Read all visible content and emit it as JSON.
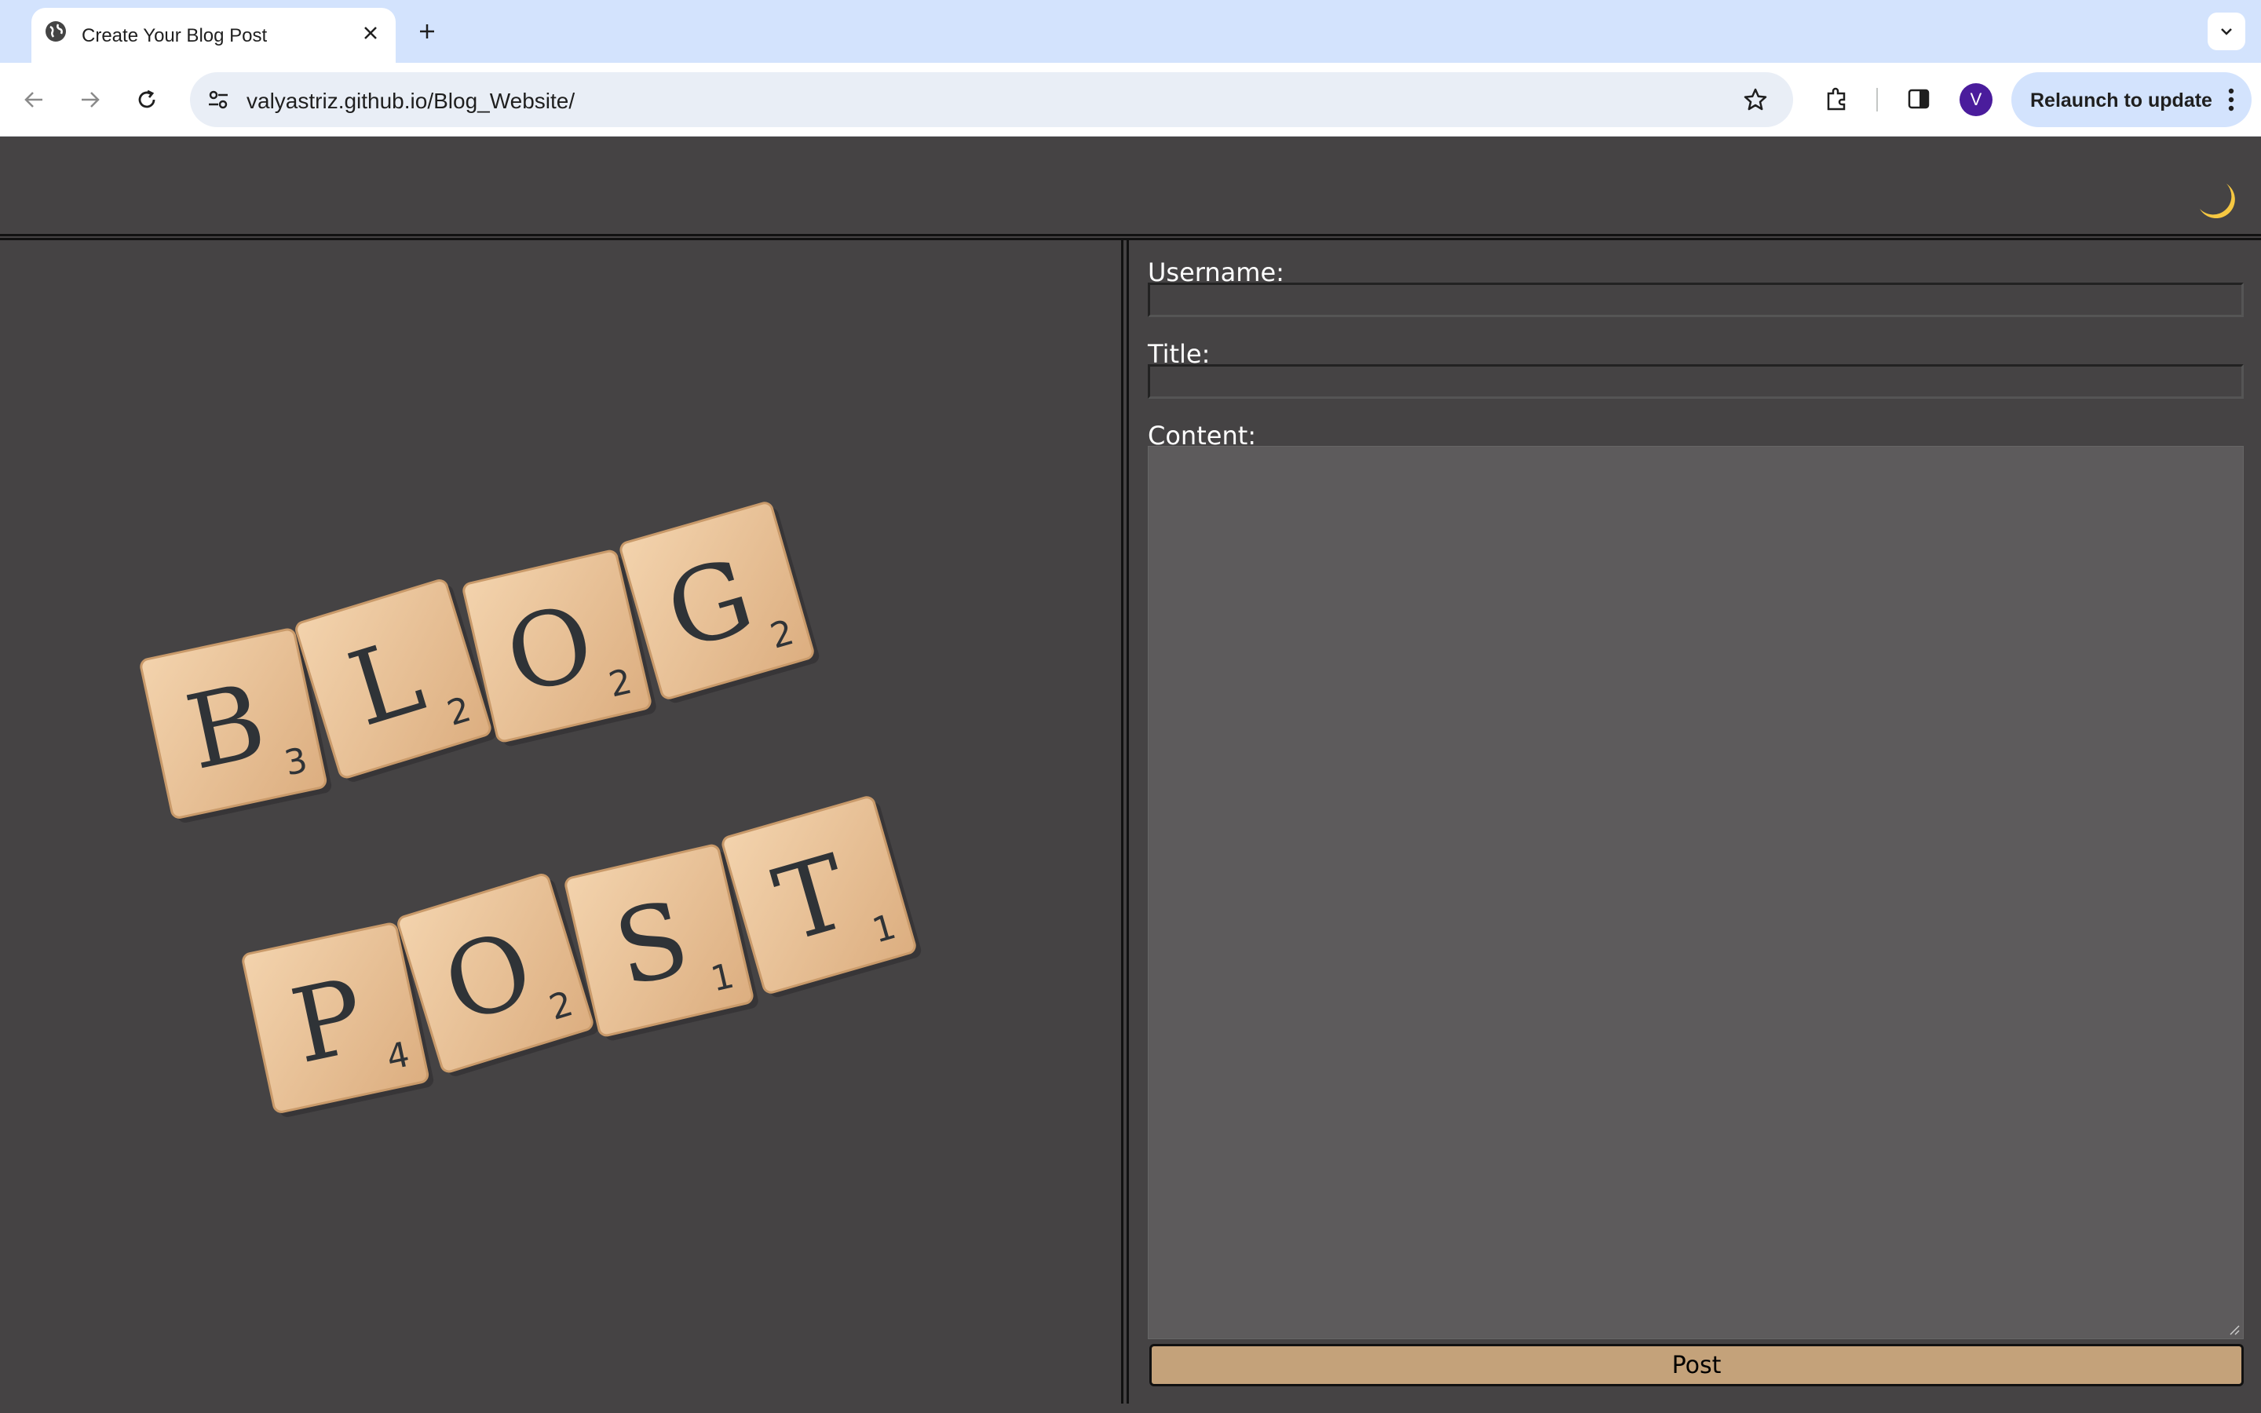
{
  "browser": {
    "tab_title": "Create Your Blog Post",
    "url": "valyastriz.github.io/Blog_Website/",
    "relaunch_label": "Relaunch to update",
    "profile_initial": "V"
  },
  "hero_image": {
    "tiles_row1": [
      {
        "letter": "B",
        "score": "3"
      },
      {
        "letter": "L",
        "score": "2"
      },
      {
        "letter": "O",
        "score": "2"
      },
      {
        "letter": "G",
        "score": "2"
      }
    ],
    "tiles_row2": [
      {
        "letter": "P",
        "score": "4"
      },
      {
        "letter": "O",
        "score": "2"
      },
      {
        "letter": "S",
        "score": "1"
      },
      {
        "letter": "T",
        "score": "1"
      }
    ]
  },
  "form": {
    "username_label": "Username:",
    "username_value": "",
    "title_label": "Title:",
    "title_value": "",
    "content_label": "Content:",
    "content_value": "",
    "submit_label": "Post"
  },
  "colors": {
    "page_bg": "#454344",
    "textarea_bg": "#5d5b5c",
    "post_button": "#c4a27a",
    "tile_wood": "#e9c39a",
    "moon": "#f6c842"
  }
}
